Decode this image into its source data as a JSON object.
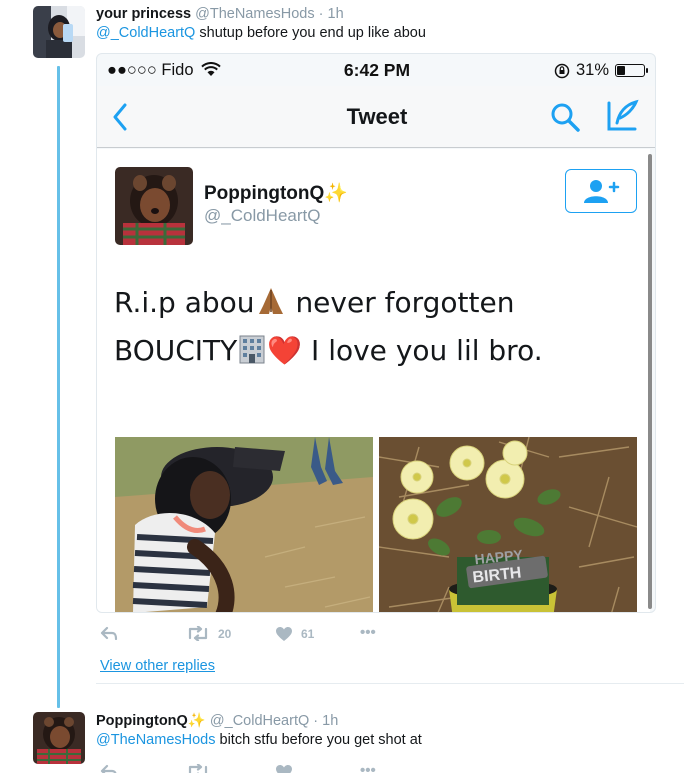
{
  "tweet1": {
    "display_name": "your princess",
    "handle": "@TheNamesHods",
    "separator": "·",
    "time": "1h",
    "mention": "@_ColdHeartQ",
    "text": "shutup before you end up like abou"
  },
  "screenshot": {
    "status": {
      "carrier": "●●○○○ Fido",
      "time": "6:42 PM",
      "battery": "31%",
      "battery_level": 0.31
    },
    "nav": {
      "title": "Tweet"
    },
    "tweet": {
      "display_name": "PoppingtonQ",
      "name_emoji": "✨",
      "handle": "@_ColdHeartQ",
      "line1_a": "R.i.p abou",
      "line1_b": "never forgotten",
      "line2_a": "BOUCITY",
      "line2_heart": "❤️",
      "line2_b": "I love you lil bro.",
      "photo2_text_1": "HAPPY",
      "photo2_text_2": "BIRTH"
    }
  },
  "tweet1_actions": {
    "retweet_count": "20",
    "like_count": "61",
    "more": "•••"
  },
  "view_replies": "View other replies",
  "tweet2": {
    "display_name": "PoppingtonQ",
    "name_emoji": "✨",
    "handle": "@_ColdHeartQ",
    "separator": "·",
    "time": "1h",
    "mention": "@TheNamesHods",
    "text": "bitch stfu before you get shot at",
    "more": "•••"
  },
  "colors": {
    "link_blue": "#1b95e0",
    "twitter_blue": "#1da1f2",
    "thread_line": "#66c0e8",
    "muted": "#8899a6"
  }
}
